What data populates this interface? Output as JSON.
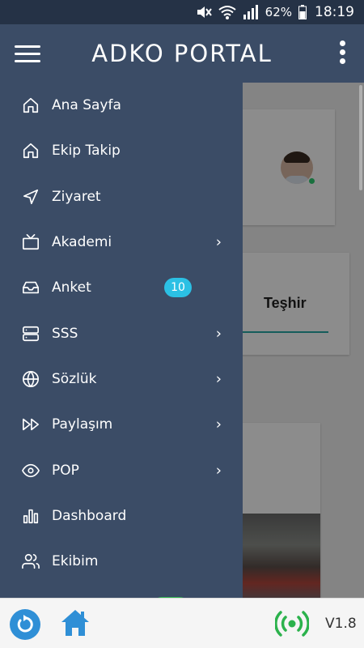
{
  "status_bar": {
    "battery": "62%",
    "time": "18:19"
  },
  "header": {
    "title": "ADKO PORTAL"
  },
  "drawer": {
    "items": [
      {
        "label": "Ana Sayfa",
        "icon": "home-icon"
      },
      {
        "label": "Ekip Takip",
        "icon": "home-icon"
      },
      {
        "label": "Ziyaret",
        "icon": "navigation-icon"
      },
      {
        "label": "Akademi",
        "icon": "tv-icon",
        "has_submenu": true
      },
      {
        "label": "Anket",
        "icon": "inbox-icon",
        "badge": "10"
      },
      {
        "label": "SSS",
        "icon": "server-icon",
        "has_submenu": true
      },
      {
        "label": "Sözlük",
        "icon": "globe-icon",
        "has_submenu": true
      },
      {
        "label": "Paylaşım",
        "icon": "fast-forward-icon",
        "has_submenu": true
      },
      {
        "label": "POP",
        "icon": "eye-icon",
        "has_submenu": true
      },
      {
        "label": "Dashboard",
        "icon": "bar-chart-icon"
      },
      {
        "label": "Ekibim",
        "icon": "users-icon"
      }
    ]
  },
  "background": {
    "card_label": "Teşhir"
  },
  "bottom_bar": {
    "version": "V1.8"
  },
  "colors": {
    "drawer_bg": "#3b4c66",
    "status_bg": "#253246",
    "badge_bg": "#2bc0e4",
    "refresh_blue": "#2f8fd6",
    "signal_green": "#2bb24c"
  }
}
